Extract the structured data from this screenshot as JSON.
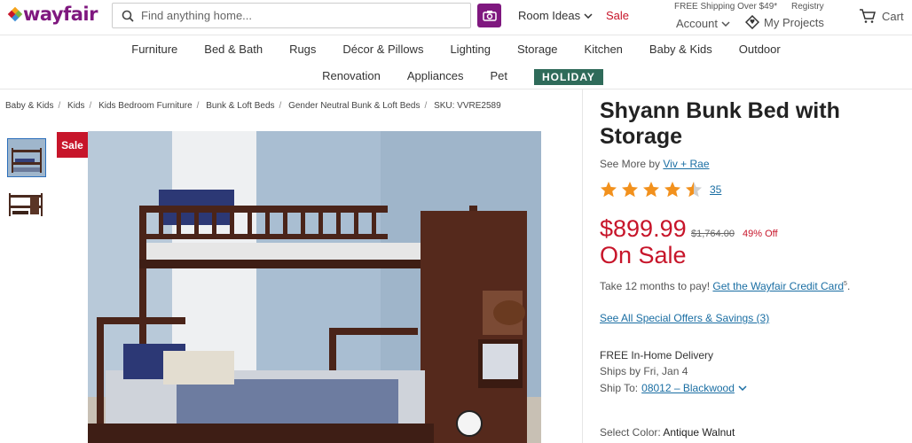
{
  "header": {
    "logo_text": "wayfair",
    "search_placeholder": "Find anything home...",
    "room_ideas": "Room Ideas",
    "sale": "Sale",
    "free_shipping": "FREE Shipping Over $49*",
    "account": "Account",
    "registry": "Registry",
    "my_projects": "My Projects",
    "cart": "Cart",
    "colors": {
      "brand": "#7f187f",
      "sale": "#c7152a"
    }
  },
  "nav": {
    "row1": [
      "Furniture",
      "Bed & Bath",
      "Rugs",
      "Décor & Pillows",
      "Lighting",
      "Storage",
      "Kitchen",
      "Baby & Kids",
      "Outdoor"
    ],
    "row2": [
      "Renovation",
      "Appliances",
      "Pet"
    ],
    "holiday": "HOLIDAY"
  },
  "breadcrumb": {
    "items": [
      "Baby & Kids",
      "Kids",
      "Kids Bedroom Furniture",
      "Bunk & Loft Beds",
      "Gender Neutral Bunk & Loft Beds"
    ],
    "sku": "SKU: VVRE2589"
  },
  "gallery": {
    "sale_badge": "Sale"
  },
  "product": {
    "title": "Shyann Bunk Bed with Storage",
    "see_more_prefix": "See More by",
    "brand": "Viv + Rae",
    "rating": 4.5,
    "rating_count": "35",
    "price": "$899.99",
    "original_price": "$1,764.00",
    "percent_off": "49% Off",
    "on_sale": "On Sale",
    "credit_prefix": "Take 12 months to pay!",
    "credit_link": "Get the Wayfair Credit Card",
    "credit_sup": "5",
    "credit_suffix": ".",
    "offers_link": "See All Special Offers & Savings (3)",
    "delivery": "FREE In-Home Delivery",
    "ships_by": "Ships by Fri, Jan 4",
    "ship_to_label": "Ship To:",
    "ship_to_value": "08012 – Blackwood",
    "select_color_label": "Select Color:",
    "select_color_value": "Antique Walnut"
  }
}
